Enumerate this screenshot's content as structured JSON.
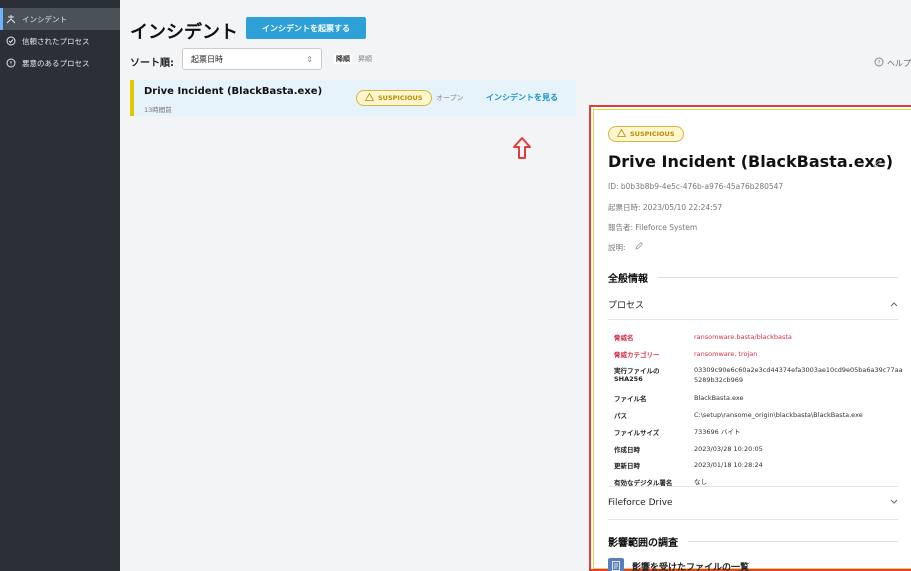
{
  "sidebar": {
    "items": [
      {
        "label": "インシデント",
        "icon": "incident-icon",
        "active": true
      },
      {
        "label": "信頼されたプロセス",
        "icon": "shield-check-icon",
        "active": false
      },
      {
        "label": "悪意のあるプロセス",
        "icon": "warning-circle-icon",
        "active": false
      }
    ]
  },
  "header": {
    "title": "インシデント",
    "create_button": "インシデントを起票する",
    "sort_label": "ソート順:",
    "sort_value": "起票日時",
    "sort_desc": "降順",
    "sort_asc": "昇順",
    "help": "ヘルプ"
  },
  "incident": {
    "title": "Drive Incident (BlackBasta.exe)",
    "time_ago": "13時間前",
    "badge": "SUSPICIOUS",
    "status": "オープン",
    "view_link": "インシデントを見る"
  },
  "detail": {
    "badge": "SUSPICIOUS",
    "title": "Drive Incident (BlackBasta.exe)",
    "id": "ID: b0b3b8b9-4e5c-476b-a976-45a76b280547",
    "created": "起票日時: 2023/05/10 22:24:57",
    "reporter": "報告者: Fileforce System",
    "description": "説明:",
    "general_section": "全般情報",
    "process_header": "プロセス",
    "process_fields": [
      {
        "key": "脅威名",
        "value": "ransomware.basta/blackbasta",
        "highlight": true
      },
      {
        "key": "脅威カテゴリー",
        "value": "ransomware, trojan",
        "highlight": true
      },
      {
        "key": "実行ファイルの SHA256",
        "value": "03309c90e6c60a2e3cd44374efa3003ae10cd9e05ba6a39c77aa5289b32cb969",
        "highlight": false
      },
      {
        "key": "ファイル名",
        "value": "BlackBasta.exe",
        "highlight": false
      },
      {
        "key": "パス",
        "value": "C:\\setup\\ransome_origin\\blackbasta\\BlackBasta.exe",
        "highlight": false
      },
      {
        "key": "ファイルサイズ",
        "value": "733696 バイト",
        "highlight": false
      },
      {
        "key": "作成日時",
        "value": "2023/03/28 10:20:05",
        "highlight": false
      },
      {
        "key": "更新日時",
        "value": "2023/01/18 10:28:24",
        "highlight": false
      },
      {
        "key": "有効なデジタル署名",
        "value": "なし",
        "highlight": false
      }
    ],
    "drive_header": "Fileforce Drive",
    "impact_section": "影響範囲の調査",
    "affected_files": "影響を受けたファイルの一覧"
  },
  "colors": {
    "sidebar_bg": "#2b3036",
    "accent": "#2da0d8",
    "badge_yellow": "#fff6cf",
    "threat_red": "#d6314c",
    "highlight_border": "#e23c3c"
  }
}
